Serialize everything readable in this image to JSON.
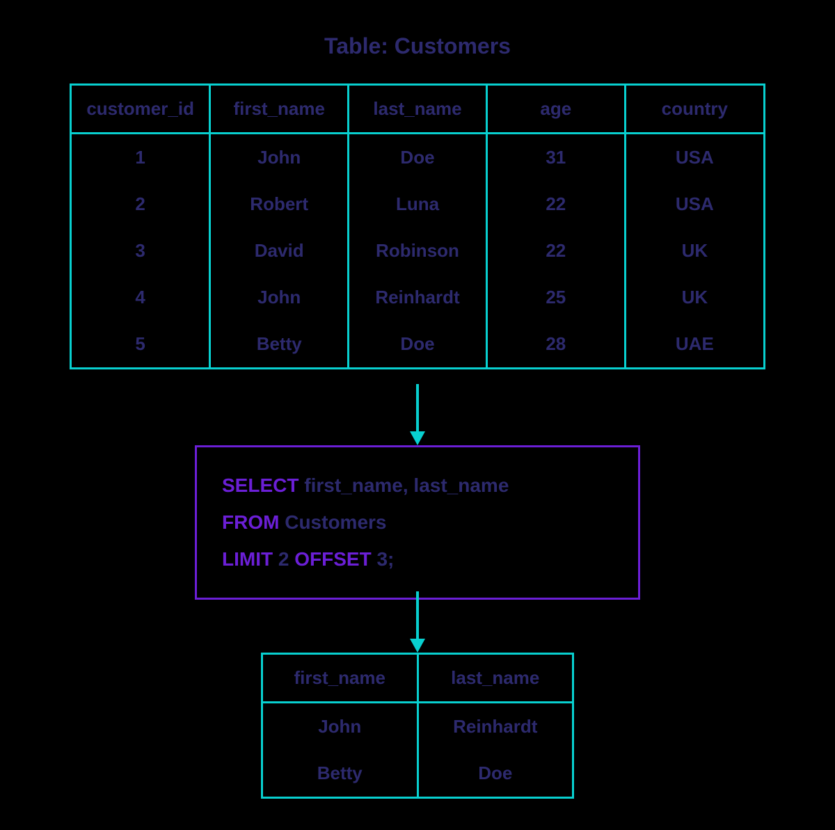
{
  "title": "Table: Customers",
  "source": {
    "columns": [
      "customer_id",
      "first_name",
      "last_name",
      "age",
      "country"
    ],
    "rows": [
      [
        "1",
        "John",
        "Doe",
        "31",
        "USA"
      ],
      [
        "2",
        "Robert",
        "Luna",
        "22",
        "USA"
      ],
      [
        "3",
        "David",
        "Robinson",
        "22",
        "UK"
      ],
      [
        "4",
        "John",
        "Reinhardt",
        "25",
        "UK"
      ],
      [
        "5",
        "Betty",
        "Doe",
        "28",
        "UAE"
      ]
    ]
  },
  "sql": {
    "line1": {
      "kw": "SELECT",
      "rest": " first_name, last_name"
    },
    "line2": {
      "kw": "FROM",
      "rest": " Customers"
    },
    "line3": {
      "kw": "LIMIT",
      "mid": " 2 ",
      "kw2": "OFFSET",
      "rest": " 3;"
    }
  },
  "result": {
    "columns": [
      "first_name",
      "last_name"
    ],
    "rows": [
      [
        "John",
        "Reinhardt"
      ],
      [
        "Betty",
        "Doe"
      ]
    ]
  },
  "colors": {
    "teal": "#08d0d0",
    "purple": "#6b1fd6",
    "navy": "#2d2a6e"
  }
}
